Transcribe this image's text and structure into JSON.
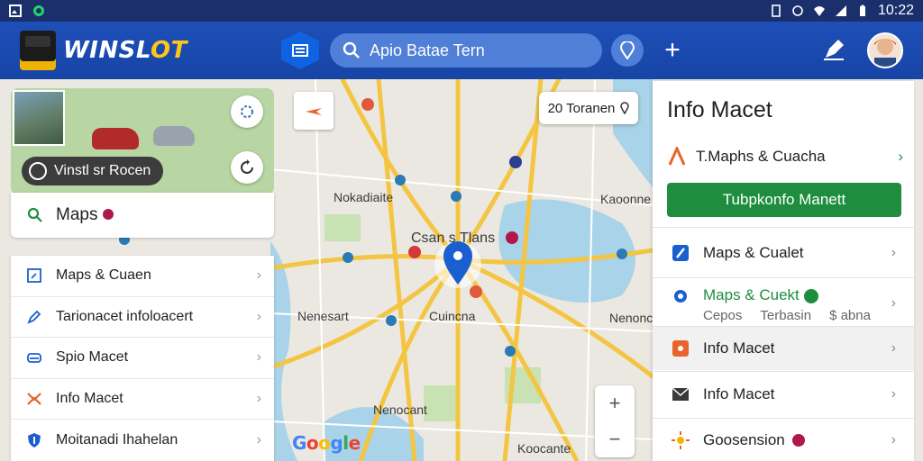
{
  "statusbar": {
    "time": "10:22"
  },
  "appbar": {
    "logo_main": "WINSL",
    "logo_accent": "OT",
    "search_placeholder": "Apio Batae Tern"
  },
  "left_card": {
    "route_chip": "Vinstl sr Rocen",
    "maps_search": "Maps"
  },
  "left_menu": {
    "items": [
      {
        "label": "Maps & Cuaen",
        "icon": "map-square-icon"
      },
      {
        "label": "Tarionacet infoloacert",
        "icon": "pen-icon"
      },
      {
        "label": "Spio Macet",
        "icon": "car-icon"
      },
      {
        "label": "Info Macet",
        "icon": "flame-icon"
      },
      {
        "label": "Moitanadi Ihahelan",
        "icon": "shield-icon"
      }
    ]
  },
  "map": {
    "callout": "20 Toranen",
    "labels": {
      "nokadiaite": "Nokadiaite",
      "center": "Csan s Tlans",
      "nenesart": "Nenesart",
      "cuincna": "Cuincna",
      "kaoonne": "Kaoonne",
      "nenoncir": "Nenoncir",
      "nenocant": "Nenocant",
      "koocante": "Koocante"
    },
    "google": [
      "G",
      "o",
      "o",
      "g",
      "l",
      "e"
    ],
    "zoom_in": "+",
    "zoom_out": "−"
  },
  "right_panel": {
    "title": "Info Macet",
    "head_row": "T.Maphs & Cuacha",
    "green_button": "Tubpkonfo Manett",
    "items": [
      {
        "label": "Maps & Cualet",
        "icon": "route-icon"
      },
      {
        "label": "Maps & Cuekt",
        "icon": "settings-gear-icon",
        "sub": [
          "Cepos",
          "Terbasin",
          "$ abna"
        ]
      },
      {
        "label": "Info Macet",
        "icon": "orange-square-icon"
      },
      {
        "label": "Info Macet",
        "icon": "mail-icon"
      },
      {
        "label": "Goosension",
        "icon": "sun-icon"
      }
    ]
  },
  "colors": {
    "appbar": "#1e4fb8",
    "accent_green": "#1e8e3e",
    "pin_blue": "#1a5fd0",
    "road_yellow": "#f4c542",
    "water": "#a9d3e8"
  }
}
